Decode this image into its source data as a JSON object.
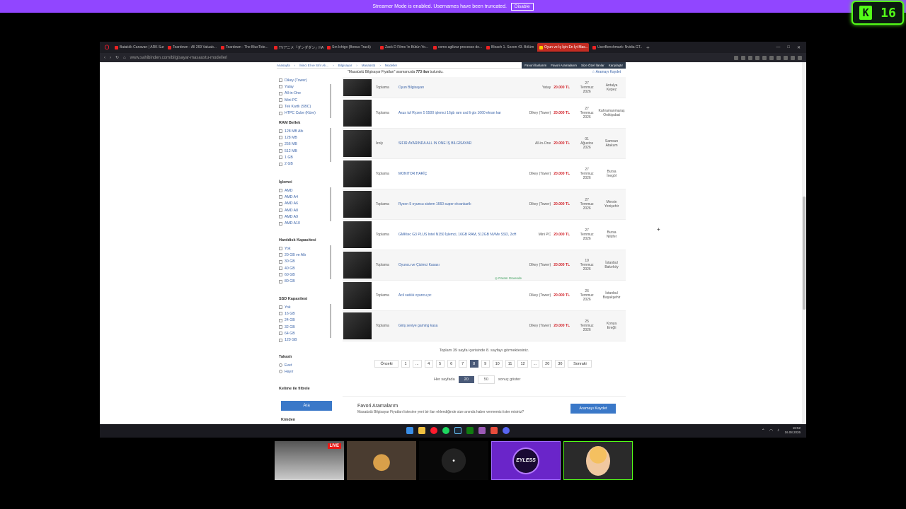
{
  "streamer": {
    "message": "Streamer Mode is enabled. Usernames have been truncated.",
    "button": "Disable"
  },
  "kick": {
    "logo": "K",
    "count": "16"
  },
  "tabs": [
    {
      "label": "Bataklık Canavarı | ARK Sur...",
      "active": false
    },
    {
      "label": "Teardown - All 269 Valuab...",
      "active": false
    },
    {
      "label": "Teardown - The BlueTide...",
      "active": false
    },
    {
      "label": "TVアニメ『ダンダダン』HAYAGI...",
      "active": false
    },
    {
      "label": "Sın Ichigo (Bonus Track)",
      "active": false
    },
    {
      "label": "Zack D Films 'in Bütün Yo...",
      "active": false
    },
    {
      "label": "como agilizar processo de...",
      "active": false
    },
    {
      "label": "Bleach 1. Sezon 43. Bölüm",
      "active": false
    },
    {
      "label": "Oyun ve İş İçin En İyi Mas...",
      "active": true
    },
    {
      "label": "UserBenchmark: Nvidia GT...",
      "active": false
    }
  ],
  "url": "www.sahibinden.com/bilgisayar-masaustu-modelleri",
  "breadcrumb": [
    "Anasayfa",
    "İkinci El ve Sıfır Alı...",
    "Bilgisayar",
    "Masaüstü",
    "Modeller"
  ],
  "topnav_right": [
    "Favori İlanlarım",
    "Favori Aramalarım",
    "Size Özel İlanlar",
    "Karşılaştır"
  ],
  "info": {
    "prefix": "\"Masaüstü Bilgisayar Fiyatları\" aramanızda",
    "count": "773 ilan",
    "suffix": "bulundu.",
    "save": "Aramayı Kaydet"
  },
  "filters": {
    "kasa": [
      "Dikey (Tower)",
      "Yatay",
      "All-in-One",
      "Mini PC",
      "Tek Kartlı (SBC)",
      "HTPC Cube (Küre)"
    ],
    "ram": {
      "title": "RAM Bellek",
      "items": [
        "128 MB Altı",
        "128 MB",
        "256 MB",
        "512 MB",
        "1 GB",
        "2 GB"
      ]
    },
    "cpu": {
      "title": "İşlemci",
      "items": [
        "AMD",
        "AMD A4",
        "AMD A6",
        "AMD A8",
        "AMD A9",
        "AMD A10"
      ]
    },
    "hdd": {
      "title": "Harddisk Kapasitesi",
      "items": [
        "Yok",
        "20 GB ve Altı",
        "30 GB",
        "40 GB",
        "60 GB",
        "80 GB"
      ]
    },
    "ssd": {
      "title": "SSD Kapasitesi",
      "items": [
        "Yok",
        "16 GB",
        "24 GB",
        "32 GB",
        "64 GB",
        "120 GB"
      ]
    },
    "takas": {
      "title": "Takaslı",
      "items": [
        "Evet",
        "Hayır"
      ]
    },
    "keyword": {
      "title": "Kelime ile filtrele"
    },
    "search_button": "Ara",
    "kimden": "Kimden"
  },
  "listings": [
    {
      "cat": "Toplama",
      "title": "Oyun Bilgisayarı",
      "type": "Yatay",
      "price": "20.000 TL",
      "date": [
        "27",
        "Temmuz",
        "2026"
      ],
      "loc": [
        "Antalya",
        "Kepez"
      ],
      "badge": ""
    },
    {
      "cat": "Toplama",
      "title": "Asus tuf Ryzen 5 5500 işlemci 16gb ram ssd li gtx 1660 ekran kar",
      "type": "Dikey (Tower)",
      "price": "20.000 TL",
      "date": [
        "27",
        "Temmuz",
        "2026"
      ],
      "loc": [
        "Kahramanmaraş",
        "Onikişubat"
      ],
      "badge": ""
    },
    {
      "cat": "İzoly",
      "title": "SIFIR AYARINDA ALL IN ONE İŞ BİLGİSAYAR",
      "type": "All-in-One",
      "price": "20.000 TL",
      "date": [
        "01",
        "Ağustos",
        "2026"
      ],
      "loc": [
        "Samsun",
        "Atakum"
      ],
      "badge": ""
    },
    {
      "cat": "Toplama",
      "title": "MONITOR HARİÇ",
      "type": "Dikey (Tower)",
      "price": "20.000 TL",
      "date": [
        "27",
        "Temmuz",
        "2026"
      ],
      "loc": [
        "Bursa",
        "İnegöl"
      ],
      "badge": ""
    },
    {
      "cat": "Toplama",
      "title": "Ryzen 5 oyuncu sistem 1660 super ekrankartlı",
      "type": "Dikey (Tower)",
      "price": "20.000 TL",
      "date": [
        "27",
        "Temmuz",
        "2026"
      ],
      "loc": [
        "Mersin",
        "Yenişehir"
      ],
      "badge": ""
    },
    {
      "cat": "Toplama",
      "title": "GMKtec G3 PLUS Intel N150 İşlemci, 16GB RAM, 512GB NVMe SSD, 2xH",
      "type": "Mini PC",
      "price": "20.000 TL",
      "date": [
        "27",
        "Temmuz",
        "2026"
      ],
      "loc": [
        "Bursa",
        "Nilüfer"
      ],
      "badge": ""
    },
    {
      "cat": "Toplama",
      "title": "Oyuncu ve Çizimci Kasası",
      "type": "Dikey (Tower)",
      "price": "20.000 TL",
      "date": [
        "19",
        "Temmuz",
        "2026"
      ],
      "loc": [
        "İstanbul",
        "Bakırköy"
      ],
      "badge": "Param Güvende"
    },
    {
      "cat": "Toplama",
      "title": "Acil satılık oyuncu pc",
      "type": "Dikey (Tower)",
      "price": "20.000 TL",
      "date": [
        "26",
        "Temmuz",
        "2026"
      ],
      "loc": [
        "İstanbul",
        "Başakşehir"
      ],
      "badge": ""
    },
    {
      "cat": "Toplama",
      "title": "Giriş seviye gaming kasa",
      "type": "Dikey (Tower)",
      "price": "20.000 TL",
      "date": [
        "25",
        "Temmuz",
        "2026"
      ],
      "loc": [
        "Konya",
        "Ereğli"
      ],
      "badge": ""
    }
  ],
  "pager": {
    "text": "Toplam 39 sayfa içerisinde 8. sayfayı görmektesiniz.",
    "items": [
      "Önceki",
      "1",
      "...",
      "4",
      "5",
      "6",
      "7",
      "8",
      "9",
      "10",
      "11",
      "12",
      "...",
      "20",
      "30",
      "Sonraki"
    ],
    "current": "8",
    "per_page_label": "Her sayfada",
    "per_page_options": [
      "20",
      "50"
    ],
    "per_page_selected": "20",
    "per_page_suffix": "sonuç göster"
  },
  "favori": {
    "title": "Favori Aramalarım",
    "desc": "Masaüstü Bilgisayar Fiyatları listesine yeni bir ilan eklendiğinde size anında haber vermemizi ister misiniz?",
    "button": "Aramayı Kaydet"
  },
  "taskbar": {
    "time": "18:52",
    "date": "16.08.2026"
  },
  "cams": [
    {
      "live": "LIVE"
    },
    {},
    {},
    {
      "logo": "EYLESS"
    },
    {}
  ],
  "colors": {
    "accent": "#3a78c8",
    "price": "#d2232a",
    "streamer": "#9146ff",
    "kick": "#53fc18"
  }
}
